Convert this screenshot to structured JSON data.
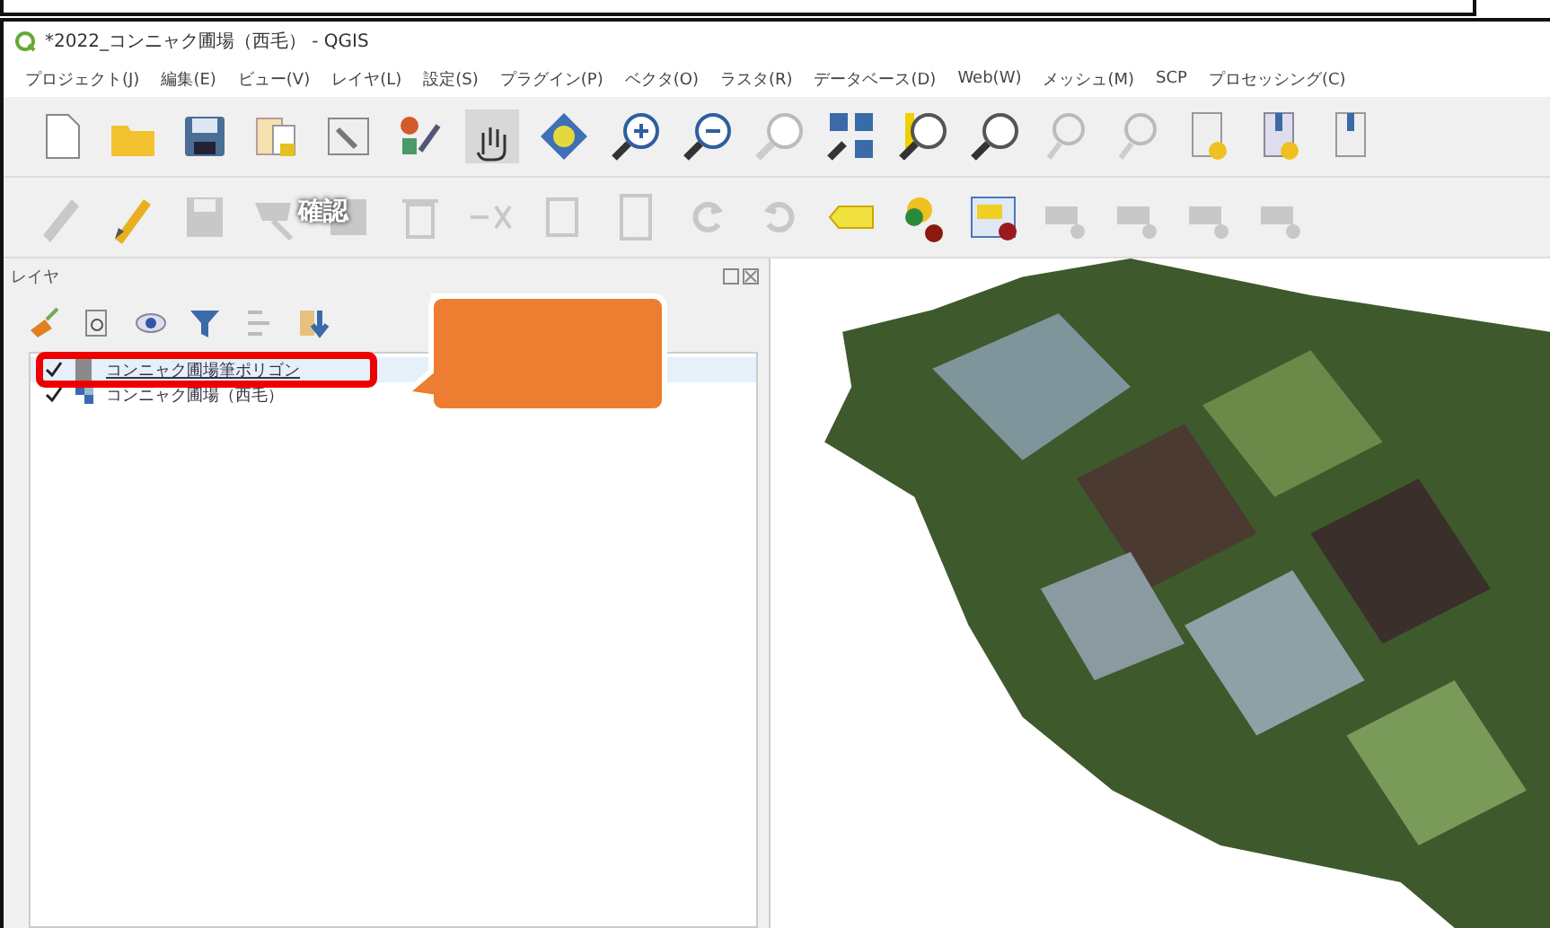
{
  "window": {
    "title": "*2022_コンニャク圃場（西毛） - QGIS"
  },
  "menu": [
    "プロジェクト(J)",
    "編集(E)",
    "ビュー(V)",
    "レイヤ(L)",
    "設定(S)",
    "プラグイン(P)",
    "ベクタ(O)",
    "ラスタ(R)",
    "データベース(D)",
    "Web(W)",
    "メッシュ(M)",
    "SCP",
    "プロセッシング(C)"
  ],
  "annotation": {
    "label": "確認"
  },
  "layers_panel": {
    "title": "レイヤ",
    "layers": [
      {
        "name": "コンニャク圃場筆ポリゴン",
        "kind": "polygon",
        "checked": true,
        "selected": true,
        "highlighted": true
      },
      {
        "name": "コンニャク圃場（西毛）",
        "kind": "raster",
        "checked": true,
        "selected": false,
        "highlighted": false
      }
    ]
  }
}
